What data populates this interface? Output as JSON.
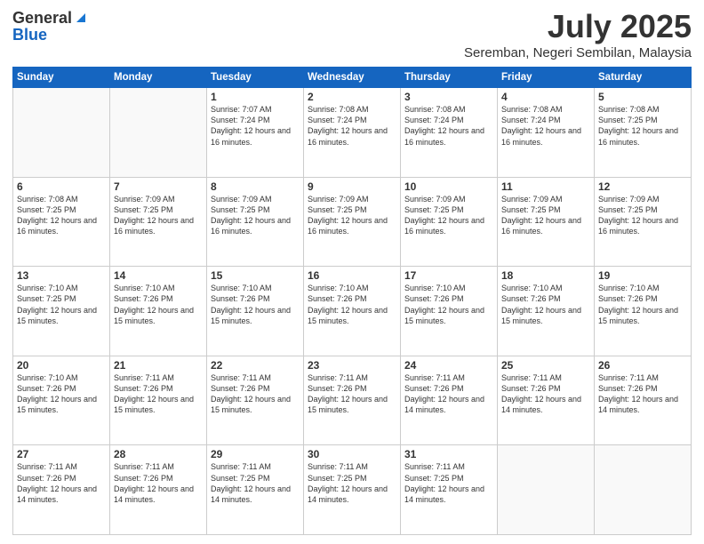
{
  "logo": {
    "general": "General",
    "blue": "Blue"
  },
  "header": {
    "month": "July 2025",
    "location": "Seremban, Negeri Sembilan, Malaysia"
  },
  "weekdays": [
    "Sunday",
    "Monday",
    "Tuesday",
    "Wednesday",
    "Thursday",
    "Friday",
    "Saturday"
  ],
  "weeks": [
    [
      {
        "day": "",
        "info": ""
      },
      {
        "day": "",
        "info": ""
      },
      {
        "day": "1",
        "info": "Sunrise: 7:07 AM\nSunset: 7:24 PM\nDaylight: 12 hours and 16 minutes."
      },
      {
        "day": "2",
        "info": "Sunrise: 7:08 AM\nSunset: 7:24 PM\nDaylight: 12 hours and 16 minutes."
      },
      {
        "day": "3",
        "info": "Sunrise: 7:08 AM\nSunset: 7:24 PM\nDaylight: 12 hours and 16 minutes."
      },
      {
        "day": "4",
        "info": "Sunrise: 7:08 AM\nSunset: 7:24 PM\nDaylight: 12 hours and 16 minutes."
      },
      {
        "day": "5",
        "info": "Sunrise: 7:08 AM\nSunset: 7:25 PM\nDaylight: 12 hours and 16 minutes."
      }
    ],
    [
      {
        "day": "6",
        "info": "Sunrise: 7:08 AM\nSunset: 7:25 PM\nDaylight: 12 hours and 16 minutes."
      },
      {
        "day": "7",
        "info": "Sunrise: 7:09 AM\nSunset: 7:25 PM\nDaylight: 12 hours and 16 minutes."
      },
      {
        "day": "8",
        "info": "Sunrise: 7:09 AM\nSunset: 7:25 PM\nDaylight: 12 hours and 16 minutes."
      },
      {
        "day": "9",
        "info": "Sunrise: 7:09 AM\nSunset: 7:25 PM\nDaylight: 12 hours and 16 minutes."
      },
      {
        "day": "10",
        "info": "Sunrise: 7:09 AM\nSunset: 7:25 PM\nDaylight: 12 hours and 16 minutes."
      },
      {
        "day": "11",
        "info": "Sunrise: 7:09 AM\nSunset: 7:25 PM\nDaylight: 12 hours and 16 minutes."
      },
      {
        "day": "12",
        "info": "Sunrise: 7:09 AM\nSunset: 7:25 PM\nDaylight: 12 hours and 16 minutes."
      }
    ],
    [
      {
        "day": "13",
        "info": "Sunrise: 7:10 AM\nSunset: 7:25 PM\nDaylight: 12 hours and 15 minutes."
      },
      {
        "day": "14",
        "info": "Sunrise: 7:10 AM\nSunset: 7:26 PM\nDaylight: 12 hours and 15 minutes."
      },
      {
        "day": "15",
        "info": "Sunrise: 7:10 AM\nSunset: 7:26 PM\nDaylight: 12 hours and 15 minutes."
      },
      {
        "day": "16",
        "info": "Sunrise: 7:10 AM\nSunset: 7:26 PM\nDaylight: 12 hours and 15 minutes."
      },
      {
        "day": "17",
        "info": "Sunrise: 7:10 AM\nSunset: 7:26 PM\nDaylight: 12 hours and 15 minutes."
      },
      {
        "day": "18",
        "info": "Sunrise: 7:10 AM\nSunset: 7:26 PM\nDaylight: 12 hours and 15 minutes."
      },
      {
        "day": "19",
        "info": "Sunrise: 7:10 AM\nSunset: 7:26 PM\nDaylight: 12 hours and 15 minutes."
      }
    ],
    [
      {
        "day": "20",
        "info": "Sunrise: 7:10 AM\nSunset: 7:26 PM\nDaylight: 12 hours and 15 minutes."
      },
      {
        "day": "21",
        "info": "Sunrise: 7:11 AM\nSunset: 7:26 PM\nDaylight: 12 hours and 15 minutes."
      },
      {
        "day": "22",
        "info": "Sunrise: 7:11 AM\nSunset: 7:26 PM\nDaylight: 12 hours and 15 minutes."
      },
      {
        "day": "23",
        "info": "Sunrise: 7:11 AM\nSunset: 7:26 PM\nDaylight: 12 hours and 15 minutes."
      },
      {
        "day": "24",
        "info": "Sunrise: 7:11 AM\nSunset: 7:26 PM\nDaylight: 12 hours and 14 minutes."
      },
      {
        "day": "25",
        "info": "Sunrise: 7:11 AM\nSunset: 7:26 PM\nDaylight: 12 hours and 14 minutes."
      },
      {
        "day": "26",
        "info": "Sunrise: 7:11 AM\nSunset: 7:26 PM\nDaylight: 12 hours and 14 minutes."
      }
    ],
    [
      {
        "day": "27",
        "info": "Sunrise: 7:11 AM\nSunset: 7:26 PM\nDaylight: 12 hours and 14 minutes."
      },
      {
        "day": "28",
        "info": "Sunrise: 7:11 AM\nSunset: 7:26 PM\nDaylight: 12 hours and 14 minutes."
      },
      {
        "day": "29",
        "info": "Sunrise: 7:11 AM\nSunset: 7:25 PM\nDaylight: 12 hours and 14 minutes."
      },
      {
        "day": "30",
        "info": "Sunrise: 7:11 AM\nSunset: 7:25 PM\nDaylight: 12 hours and 14 minutes."
      },
      {
        "day": "31",
        "info": "Sunrise: 7:11 AM\nSunset: 7:25 PM\nDaylight: 12 hours and 14 minutes."
      },
      {
        "day": "",
        "info": ""
      },
      {
        "day": "",
        "info": ""
      }
    ]
  ]
}
